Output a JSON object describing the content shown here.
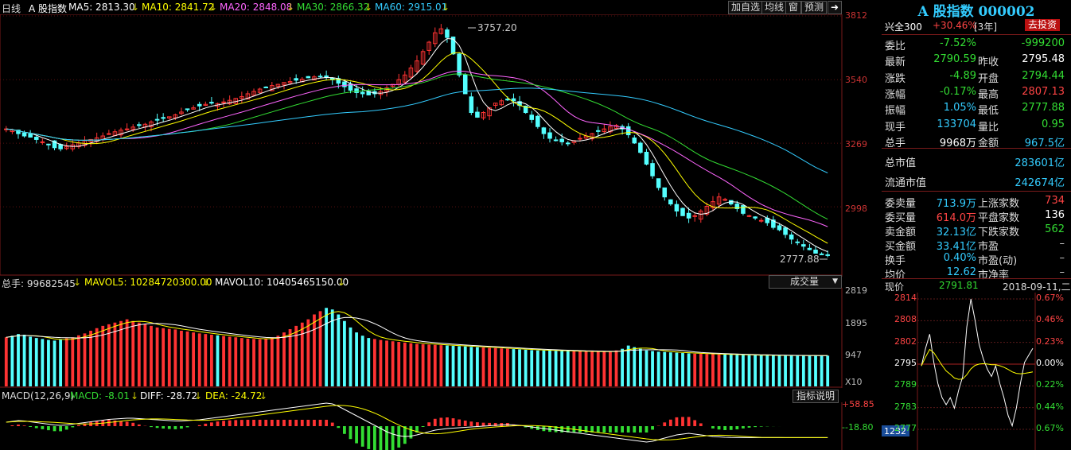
{
  "main": {
    "period": "日线",
    "name": "A 股指数",
    "ma": [
      {
        "label": "MA5: 2813.30",
        "color": "#ffffff"
      },
      {
        "label": "MA10: 2841.72",
        "color": "#ffff00"
      },
      {
        "label": "MA20: 2848.08",
        "color": "#ff66ff"
      },
      {
        "label": "MA30: 2866.32",
        "color": "#33dd33"
      },
      {
        "label": "MA60: 2915.01",
        "color": "#33ccff"
      }
    ],
    "buttons": [
      "加自选",
      "均线",
      "窗",
      "预测"
    ],
    "y_ticks": [
      "3812",
      "3540",
      "3269",
      "2998"
    ],
    "high_label": "3757.20",
    "low_label": "2777.88"
  },
  "volume": {
    "total": "总手: 99682545",
    "mavol5": "MAVOL5: 10284720300.00",
    "mavol10": "MAVOL10: 10405465150.00",
    "dropdown": "成交量",
    "y_ticks": [
      "2819",
      "1895",
      "947"
    ],
    "unit": "X10"
  },
  "macd": {
    "title": "MACD(12,26,9)",
    "macd": "MACD: -8.01",
    "diff": "DIFF: -28.72",
    "dea": "DEA: -24.72",
    "help": "指标说明",
    "y_ticks": [
      "58.85",
      "-18.80"
    ]
  },
  "panel": {
    "title": "A 股指数 000002",
    "tag_left": "兴全300",
    "tag_pct": "+30.46%",
    "tag_period": "[3年]",
    "tag_button": "去投资",
    "rows": [
      {
        "l1": "委比",
        "v1": "-7.52%",
        "c1": "#33dd33",
        "l2": "",
        "v2": "-999200",
        "c2": "#33dd33"
      },
      {
        "l1": "最新",
        "v1": "2790.59",
        "c1": "#33dd33",
        "l2": "昨收",
        "v2": "2795.48",
        "c2": "#ffffff"
      },
      {
        "l1": "涨跌",
        "v1": "-4.89",
        "c1": "#33dd33",
        "l2": "开盘",
        "v2": "2794.44",
        "c2": "#33dd33"
      },
      {
        "l1": "涨幅",
        "v1": "-0.17%",
        "c1": "#33dd33",
        "l2": "最高",
        "v2": "2807.13",
        "c2": "#ff4444"
      },
      {
        "l1": "振幅",
        "v1": "1.05%",
        "c1": "#33ccff",
        "l2": "最低",
        "v2": "2777.88",
        "c2": "#33dd33"
      },
      {
        "l1": "现手",
        "v1": "133704",
        "c1": "#33ccff",
        "l2": "量比",
        "v2": "0.95",
        "c2": "#33dd33"
      },
      {
        "l1": "总手",
        "v1": "9968万",
        "c1": "#ffffff",
        "l2": "金额",
        "v2": "967.5亿",
        "c2": "#33ccff"
      }
    ],
    "market": [
      {
        "l": "总市值",
        "v": "283601亿"
      },
      {
        "l": "流通市值",
        "v": "242674亿"
      }
    ],
    "orders": [
      {
        "l1": "委卖量",
        "v1": "713.9万",
        "c1": "#33ccff",
        "l2": "上涨家数",
        "v2": "734",
        "c2": "#ff4444"
      },
      {
        "l1": "委买量",
        "v1": "614.0万",
        "c1": "#ff4444",
        "l2": "平盘家数",
        "v2": "136",
        "c2": "#ffffff"
      },
      {
        "l1": "卖金额",
        "v1": "32.13亿",
        "c1": "#33ccff",
        "l2": "下跌家数",
        "v2": "562",
        "c2": "#33dd33"
      },
      {
        "l1": "买金额",
        "v1": "33.41亿",
        "c1": "#33ccff",
        "l2": "市盈",
        "v2": "–",
        "c2": "#cccccc"
      },
      {
        "l1": "换手",
        "v1": "0.40%",
        "c1": "#33ccff",
        "l2": "市盈(动)",
        "v2": "–",
        "c2": "#cccccc"
      },
      {
        "l1": "均价",
        "v1": "12.62",
        "c1": "#33ccff",
        "l2": "市净率",
        "v2": "–",
        "c2": "#cccccc"
      }
    ],
    "mini": {
      "label": "现价",
      "price": "2791.81",
      "date": "2018-09-11,二",
      "left_ticks": [
        "2814",
        "2808",
        "2802",
        "2795",
        "2789",
        "2783",
        "2777"
      ],
      "right_ticks": [
        "0.67%",
        "0.46%",
        "0.23%",
        "0.00%",
        "0.22%",
        "0.44%",
        "0.67%"
      ],
      "vol_label": "1232"
    }
  },
  "chart_data": {
    "type": "line",
    "ylim": [
      2700,
      3812
    ],
    "annotations": [
      {
        "text": "3757.20",
        "y": 3757.2
      },
      {
        "text": "2777.88",
        "y": 2777.88
      }
    ],
    "close": [
      3330,
      3325,
      3310,
      3300,
      3295,
      3285,
      3275,
      3265,
      3250,
      3245,
      3255,
      3262,
      3270,
      3280,
      3285,
      3292,
      3300,
      3310,
      3318,
      3325,
      3330,
      3338,
      3345,
      3350,
      3360,
      3368,
      3375,
      3382,
      3390,
      3402,
      3412,
      3420,
      3428,
      3435,
      3440,
      3438,
      3445,
      3452,
      3460,
      3468,
      3480,
      3490,
      3500,
      3508,
      3515,
      3520,
      3528,
      3532,
      3538,
      3542,
      3548,
      3552,
      3555,
      3550,
      3540,
      3525,
      3510,
      3495,
      3485,
      3480,
      3475,
      3480,
      3490,
      3505,
      3520,
      3540,
      3560,
      3590,
      3620,
      3660,
      3700,
      3740,
      3757,
      3720,
      3650,
      3560,
      3480,
      3400,
      3380,
      3400,
      3420,
      3440,
      3450,
      3455,
      3450,
      3430,
      3400,
      3370,
      3340,
      3310,
      3290,
      3280,
      3275,
      3270,
      3280,
      3290,
      3300,
      3310,
      3320,
      3330,
      3340,
      3345,
      3330,
      3305,
      3270,
      3230,
      3180,
      3130,
      3080,
      3040,
      3010,
      2980,
      2960,
      2950,
      2960,
      2980,
      3000,
      3020,
      3040,
      3030,
      3010,
      2990,
      2970,
      2960,
      2950,
      2940,
      2930,
      2910,
      2900,
      2880,
      2860,
      2845,
      2830,
      2815,
      2800,
      2795,
      2790.59
    ],
    "volume_x10": [
      1500,
      1550,
      1600,
      1580,
      1520,
      1480,
      1450,
      1420,
      1400,
      1430,
      1470,
      1500,
      1560,
      1620,
      1700,
      1780,
      1850,
      1900,
      1950,
      2000,
      2050,
      2000,
      1950,
      1900,
      1850,
      1800,
      1780,
      1760,
      1740,
      1700,
      1680,
      1650,
      1620,
      1600,
      1580,
      1560,
      1540,
      1520,
      1500,
      1480,
      1460,
      1450,
      1440,
      1450,
      1500,
      1550,
      1650,
      1750,
      1850,
      1950,
      2050,
      2200,
      2300,
      2400,
      2350,
      2200,
      2000,
      1800,
      1650,
      1550,
      1480,
      1450,
      1420,
      1400,
      1380,
      1360,
      1340,
      1320,
      1300,
      1290,
      1280,
      1270,
      1260,
      1250,
      1240,
      1230,
      1220,
      1210,
      1200,
      1190,
      1180,
      1170,
      1160,
      1150,
      1140,
      1130,
      1120,
      1110,
      1100,
      1100,
      1095,
      1090,
      1085,
      1080,
      1075,
      1070,
      1068,
      1065,
      1060,
      1058,
      1055,
      1100,
      1150,
      1250,
      1200,
      1150,
      1100,
      1080,
      1060,
      1050,
      1040,
      1030,
      1020,
      1010,
      1000,
      995,
      990,
      985,
      980,
      975,
      970,
      965,
      960,
      955,
      950,
      950,
      948,
      947,
      946,
      945,
      944,
      943,
      942,
      941,
      940,
      939,
      938
    ],
    "macd_diff": [
      10,
      12,
      14,
      13,
      11,
      9,
      7,
      5,
      3,
      2,
      3,
      5,
      7,
      9,
      11,
      13,
      15,
      17,
      18,
      19,
      20,
      20,
      19,
      18,
      17,
      16,
      15,
      14,
      13,
      13,
      14,
      15,
      16,
      18,
      20,
      22,
      24,
      26,
      28,
      30,
      32,
      34,
      36,
      38,
      40,
      42,
      44,
      46,
      48,
      50,
      52,
      54,
      56,
      58,
      56,
      50,
      42,
      34,
      26,
      18,
      10,
      2,
      -6,
      -14,
      -20,
      -24,
      -26,
      -25,
      -22,
      -18,
      -14,
      -10,
      -8,
      -6,
      -5,
      -4,
      -3,
      -2,
      -1,
      0,
      1,
      2,
      3,
      4,
      3,
      2,
      0,
      -2,
      -4,
      -6,
      -8,
      -10,
      -12,
      -14,
      -16,
      -18,
      -20,
      -22,
      -24,
      -26,
      -28,
      -30,
      -32,
      -34,
      -36,
      -38,
      -40,
      -38,
      -34,
      -30,
      -26,
      -22,
      -20,
      -18,
      -20,
      -22,
      -24,
      -26,
      -27,
      -28,
      -28.5,
      -28.72,
      -28.7,
      -28.72,
      -28.72,
      -28.72,
      -28.72,
      -28.72,
      -28.72,
      -28.72,
      -28.72,
      -28.72,
      -28.72,
      -28.72,
      -28.72,
      -28.72,
      -28.72
    ]
  }
}
